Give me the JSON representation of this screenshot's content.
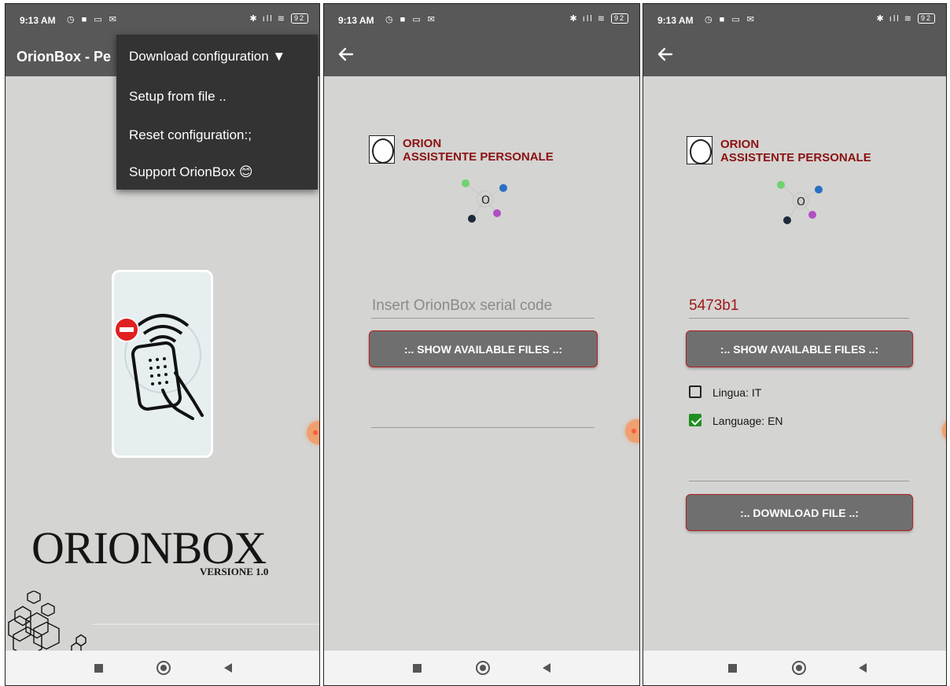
{
  "status": {
    "time": "9:13 AM",
    "left_icons": "◷ ■ ▭ ✉",
    "right_icons": "✱ ıll ≋",
    "battery": "92"
  },
  "screen1": {
    "app_title": "OrionBox - Pe",
    "menu": {
      "items": [
        "Download configuration ▼",
        "Setup from file ..",
        "Reset configuration:;",
        "Support OrionBox 😊"
      ]
    },
    "logo_text": "ORIONBOX",
    "version_text": "VERSIONE 1.0"
  },
  "screen2": {
    "brand_line1": "ORION",
    "brand_line2": "ASSISTENTE PERSONALE",
    "serial_placeholder": "Insert OrionBox serial code",
    "show_files_label": ":.. SHOW AVAILABLE FILES ..:"
  },
  "screen3": {
    "brand_line1": "ORION",
    "brand_line2": "ASSISTENTE PERSONALE",
    "serial_value": "5473b1",
    "show_files_label": ":.. SHOW AVAILABLE FILES ..:",
    "options": [
      {
        "label": "Lingua: IT",
        "checked": false
      },
      {
        "label": "Language: EN",
        "checked": true
      }
    ],
    "download_label": ":.. DOWNLOAD FILE ..:"
  },
  "colors": {
    "appbar": "#585858",
    "background": "#d4d4d2",
    "brand_red": "#8b1212",
    "button": "#6f6f6f",
    "checkbox_checked": "#1f8f1f"
  }
}
